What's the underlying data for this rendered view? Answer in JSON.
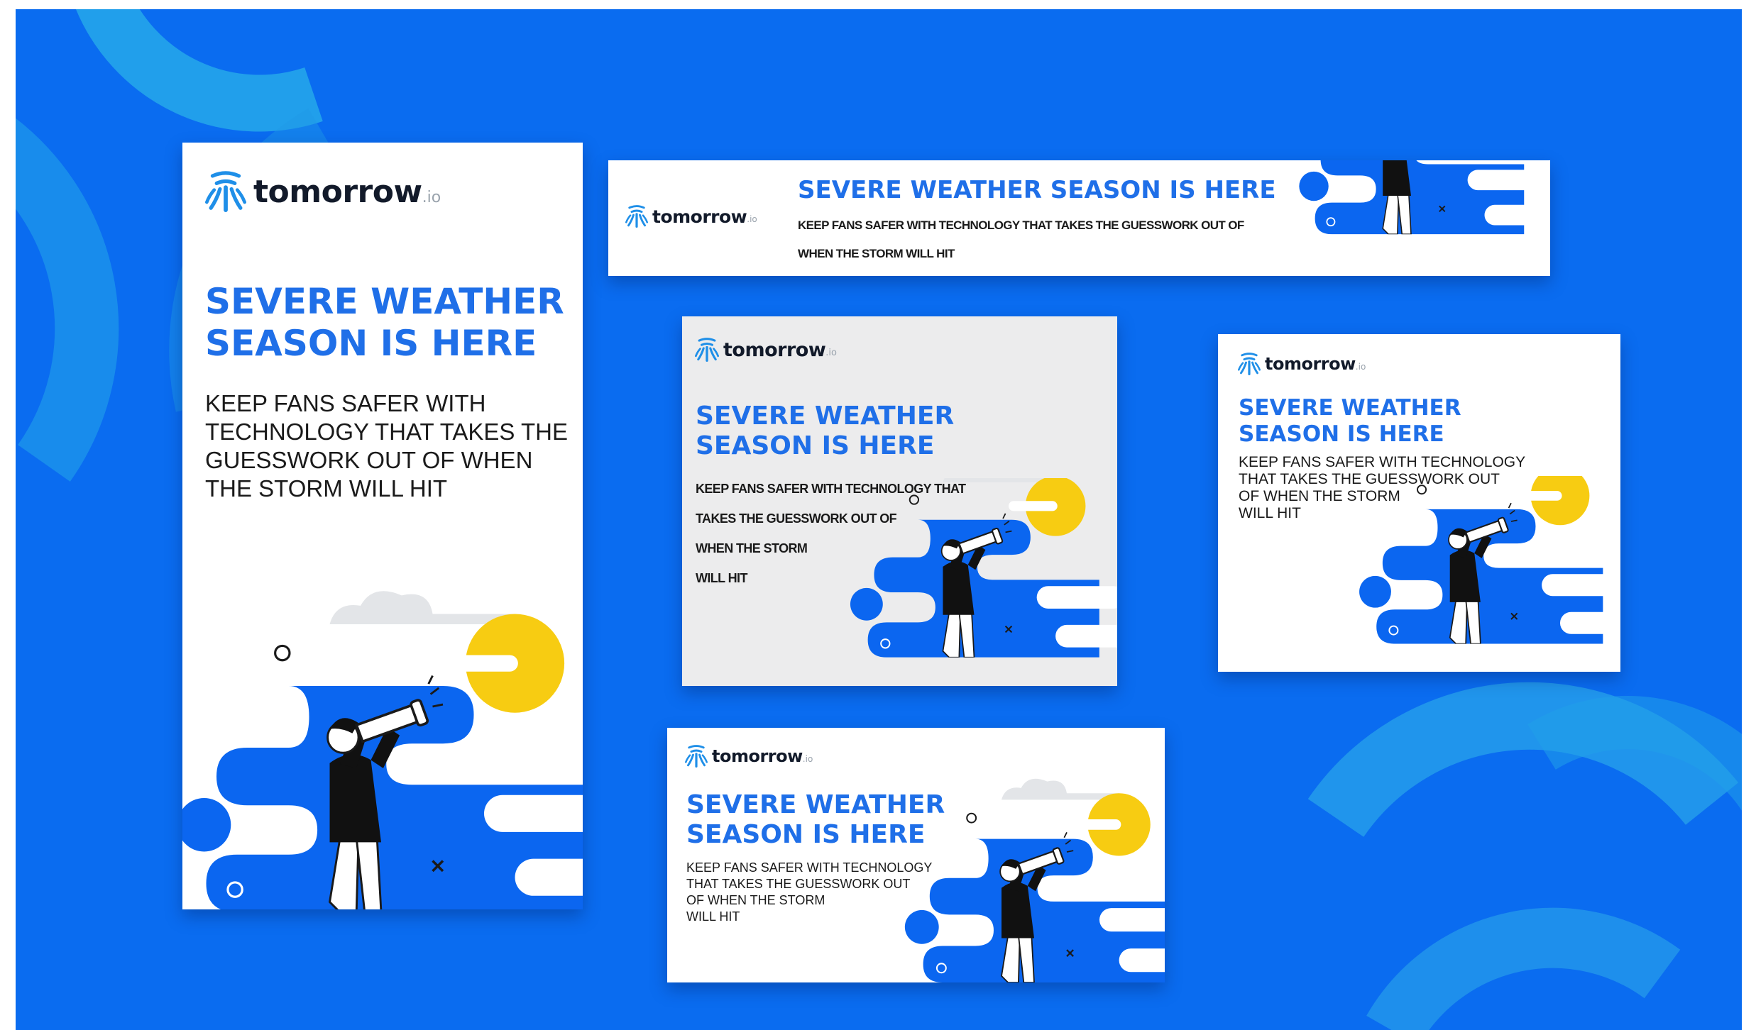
{
  "brand": {
    "name": "tomorrow",
    "suffix": ".io",
    "logo_icon": "tomorrow-io-logo-icon"
  },
  "colors": {
    "background": "#0a6cf0",
    "headline": "#1f6fe8",
    "cloud_blue": "#0b66f0",
    "sun": "#f7cc12",
    "card_white": "#ffffff",
    "card_grey": "#ececed"
  },
  "banners": [
    {
      "id": "skyscraper",
      "headline_lines": [
        "SEVERE WEATHER",
        "SEASON IS HERE"
      ],
      "body_lines": [
        "KEEP FANS SAFER WITH",
        "TECHNOLOGY THAT TAKES THE",
        "GUESSWORK OUT OF WHEN",
        "THE STORM WILL HIT"
      ]
    },
    {
      "id": "leaderboard",
      "headline_lines": [
        "SEVERE WEATHER SEASON IS HERE"
      ],
      "body_lines": [
        "KEEP FANS SAFER WITH TECHNOLOGY THAT TAKES THE GUESSWORK OUT OF",
        "WHEN THE STORM WILL HIT"
      ]
    },
    {
      "id": "square-grey",
      "headline_lines": [
        "SEVERE WEATHER",
        "SEASON IS HERE"
      ],
      "body_lines": [
        "KEEP FANS SAFER WITH TECHNOLOGY THAT",
        "TAKES THE GUESSWORK OUT OF",
        "WHEN THE STORM",
        "WILL HIT"
      ]
    },
    {
      "id": "medium-rectangle",
      "headline_lines": [
        "SEVERE WEATHER",
        "SEASON IS HERE"
      ],
      "body_lines": [
        "KEEP FANS SAFER WITH TECHNOLOGY",
        "THAT TAKES THE GUESSWORK OUT",
        "OF WHEN THE STORM",
        "WILL HIT"
      ]
    },
    {
      "id": "wide-rectangle",
      "headline_lines": [
        "SEVERE WEATHER",
        "SEASON IS HERE"
      ],
      "body_lines": [
        "KEEP FANS SAFER WITH TECHNOLOGY",
        "THAT TAKES THE GUESSWORK OUT",
        "OF WHEN THE STORM",
        "WILL HIT"
      ]
    }
  ],
  "illustration": {
    "subject": "person-looking-through-telescope-icon",
    "elements": [
      "blue-cloud-shape",
      "yellow-sun",
      "grey-cloud",
      "small-circle-marks",
      "x-mark"
    ]
  }
}
